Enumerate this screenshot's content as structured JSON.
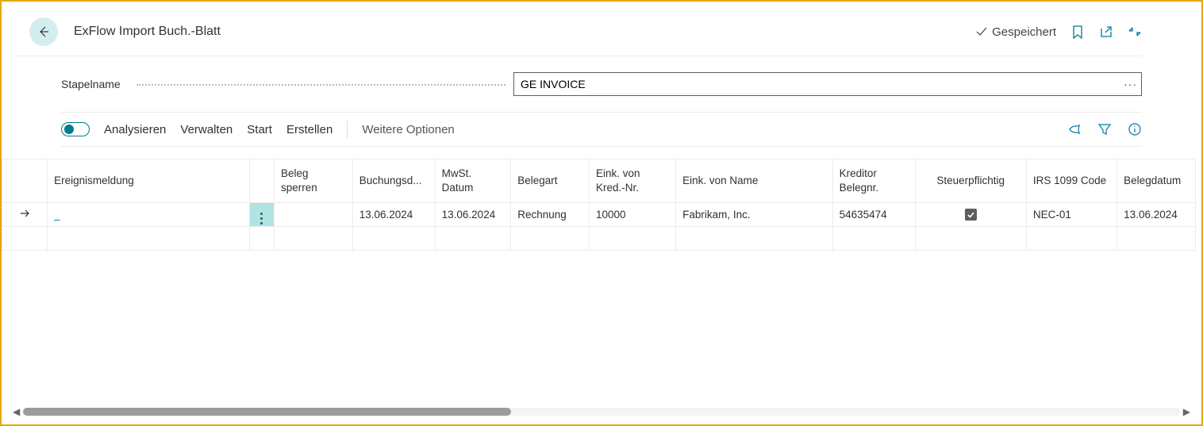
{
  "header": {
    "title": "ExFlow Import Buch.-Blatt",
    "saved_label": "Gespeichert"
  },
  "field": {
    "label": "Stapelname",
    "value": "GE INVOICE"
  },
  "toolbar": {
    "analyze": "Analysieren",
    "manage": "Verwalten",
    "start": "Start",
    "create": "Erstellen",
    "more": "Weitere Optionen"
  },
  "columns": {
    "c0": "",
    "c1": "Ereignismeldung",
    "c2": "",
    "c3": "Beleg sperren",
    "c4": "Buchungsd...",
    "c5": "MwSt. Datum",
    "c6": "Belegart",
    "c7": "Eink. von Kred.-Nr.",
    "c8": "Eink. von Name",
    "c9": "Kreditor Belegnr.",
    "c10": "Steuerpflichtig",
    "c11": "IRS 1099 Code",
    "c12": "Belegdatum"
  },
  "row": {
    "ereignis": "_",
    "buchungsdatum": "13.06.2024",
    "mwst_datum": "13.06.2024",
    "belegart": "Rechnung",
    "kred_nr": "10000",
    "name": "Fabrikam, Inc.",
    "kred_beleg": "54635474",
    "irs": "NEC-01",
    "belegdatum": "13.06.2024"
  }
}
